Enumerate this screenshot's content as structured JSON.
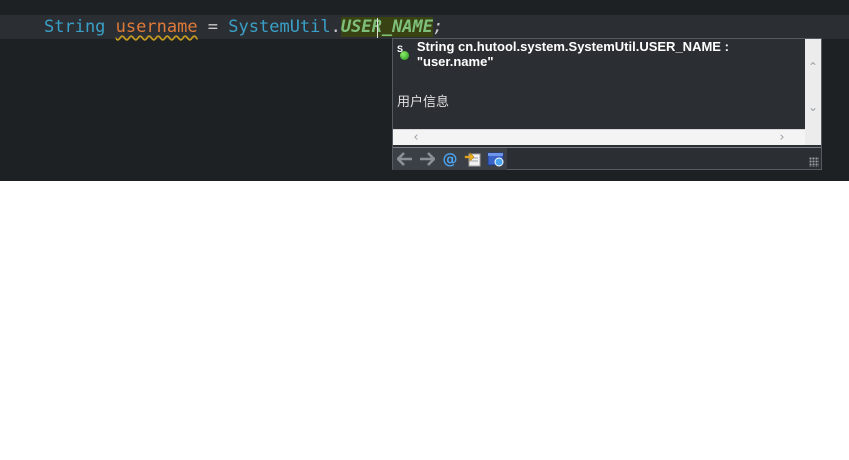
{
  "editor": {
    "code": {
      "type_keyword": "String",
      "variable": "username",
      "operator": " = ",
      "class_name": "SystemUtil",
      "dot": ".",
      "field": "USER_NAME",
      "semicolon": ";"
    }
  },
  "popup": {
    "signature": "String cn.hutool.system.SystemUtil.USER_NAME : \"user.name\"",
    "description": "用户信息",
    "field_icon_letter": "S",
    "toolbar": {
      "icons": [
        "back-arrow-icon",
        "forward-arrow-icon",
        "at-icon",
        "open-declaration-icon",
        "open-browser-icon"
      ]
    }
  },
  "colors": {
    "editor_bg": "#1e2124",
    "keyword": "#3aa0c8",
    "variable": "#e07a38",
    "field": "#7ec07a",
    "field_highlight": "#384212",
    "popup_bg": "#2b2f33"
  }
}
